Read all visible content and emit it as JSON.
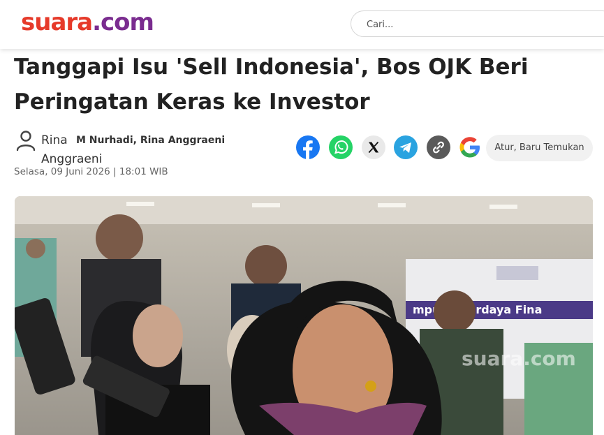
{
  "header": {
    "logo_part1": "suara",
    "logo_part2": ".com",
    "search_placeholder": "Cari..."
  },
  "article": {
    "title": "Tanggapi Isu 'Sell Indonesia', Bos OJK Beri Peringatan Keras ke Investor",
    "author_icon_alt": "Rina Anggraeni",
    "authors": "M Nurhadi, Rina Anggraeni",
    "date": "Selasa, 09 Juni 2026 | 18:01 WIB"
  },
  "share": {
    "icons": [
      "facebook-icon",
      "whatsapp-icon",
      "x-icon",
      "telegram-icon",
      "link-icon"
    ],
    "google_icon": "google-icon",
    "follow_label": "Atur, Baru Temukan"
  },
  "photo": {
    "banner_text": "mpuan Berdaya Fina",
    "watermark": "suara.com"
  },
  "colors": {
    "logo_red": "#e63a2a",
    "logo_purple": "#7a2c8f",
    "facebook": "#1877f2",
    "whatsapp": "#25d366",
    "x": "#000000",
    "telegram": "#2aa3e0",
    "link": "#555555"
  }
}
